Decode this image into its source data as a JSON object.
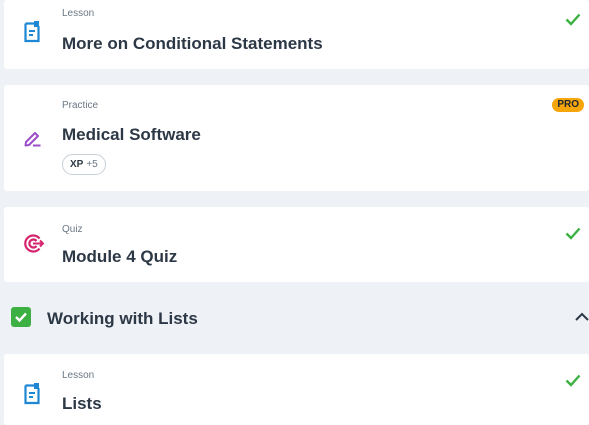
{
  "items": [
    {
      "kind": "Lesson",
      "title": "More on Conditional Statements",
      "icon": "lesson-icon",
      "completed": true
    },
    {
      "kind": "Practice",
      "title": "Medical Software",
      "icon": "practice-pencil-icon",
      "badge": "PRO",
      "xp_label": "XP",
      "xp_value": "+5"
    },
    {
      "kind": "Quiz",
      "title": "Module 4 Quiz",
      "icon": "quiz-target-icon",
      "completed": true
    }
  ],
  "section": {
    "title": "Working with Lists",
    "completed": true,
    "expanded": true
  },
  "section_items": [
    {
      "kind": "Lesson",
      "title": "Lists",
      "icon": "lesson-icon",
      "completed": true
    }
  ],
  "colors": {
    "background": "#eef1f5",
    "card": "#ffffff",
    "lesson_icon": "#1e87d3",
    "practice_icon": "#9b4dca",
    "quiz_icon": "#d6246e",
    "check": "#3cb043",
    "pro_badge": "#f6a609"
  }
}
